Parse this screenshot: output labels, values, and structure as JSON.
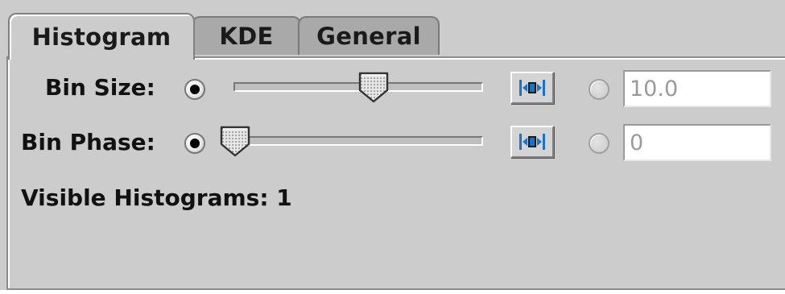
{
  "tabs": [
    {
      "label": "Histogram",
      "active": true
    },
    {
      "label": "KDE",
      "active": false
    },
    {
      "label": "General",
      "active": false
    }
  ],
  "bin_size": {
    "label": "Bin Size:",
    "slider_position_fraction": 0.56,
    "auto_radio_selected": true,
    "manual_radio_selected": false,
    "field_value": "10.0",
    "button_icon": "resize-icon"
  },
  "bin_phase": {
    "label": "Bin Phase:",
    "slider_position_fraction": 0.0,
    "auto_radio_selected": true,
    "manual_radio_selected": false,
    "field_value": "0",
    "button_icon": "resize-icon"
  },
  "visible_histograms_label": "Visible Histograms: 1",
  "colors": {
    "window_bg": "#cccccc",
    "inactive_tab_bg": "#a9a9a9",
    "icon_blue": "#1a73c8"
  }
}
